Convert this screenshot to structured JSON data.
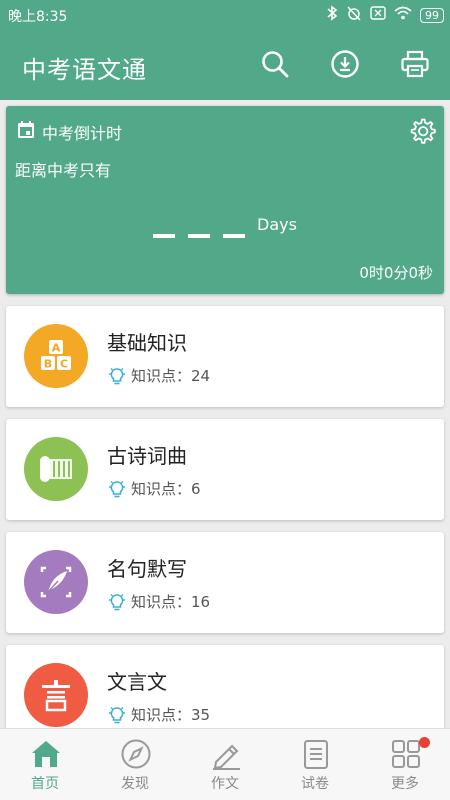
{
  "status_bar": {
    "time": "晚上8:35",
    "battery": "99"
  },
  "app_bar": {
    "title": "中考语文通"
  },
  "countdown": {
    "heading": "中考倒计时",
    "subheading": "距离中考只有",
    "days_label": "Days",
    "timer": "0时0分0秒"
  },
  "categories": [
    {
      "name": "基础知识",
      "knowledge_label": "知识点：24",
      "color": "#f3a826"
    },
    {
      "name": "古诗词曲",
      "knowledge_label": "知识点：6",
      "color": "#8dc153"
    },
    {
      "name": "名句默写",
      "knowledge_label": "知识点：16",
      "color": "#a57bbf"
    },
    {
      "name": "文言文",
      "knowledge_label": "知识点：35",
      "color": "#ef5b43"
    }
  ],
  "tabs": [
    {
      "label": "首页",
      "icon": "home-icon",
      "active": true
    },
    {
      "label": "发现",
      "icon": "compass-icon",
      "active": false
    },
    {
      "label": "作文",
      "icon": "pencil-icon",
      "active": false
    },
    {
      "label": "试卷",
      "icon": "document-icon",
      "active": false
    },
    {
      "label": "更多",
      "icon": "grid-icon",
      "active": false
    }
  ],
  "colors": {
    "primary": "#52a98a",
    "badge": "#e94234",
    "bulb": "#3ab0d6"
  }
}
